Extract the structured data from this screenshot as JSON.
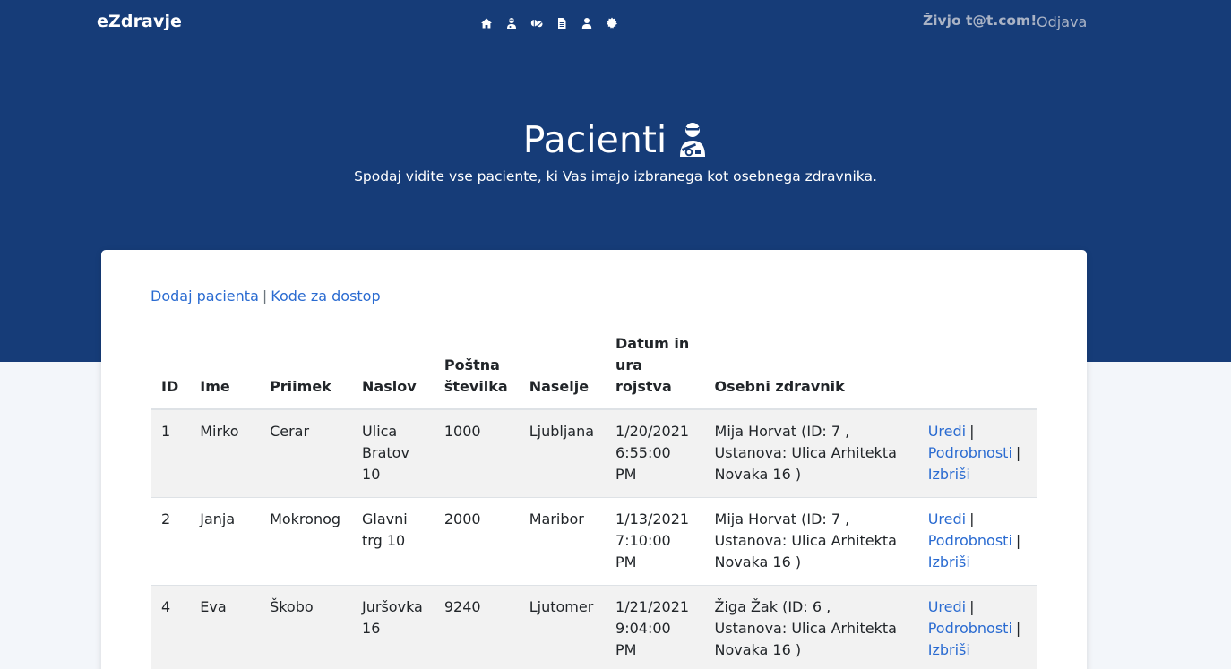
{
  "navbar": {
    "brand": "eZdravje",
    "icons": [
      "home-icon",
      "user-injured-icon",
      "pills-icon",
      "file-icon",
      "user-icon",
      "settings-icon"
    ],
    "greeting": "Živjo t@t.com!",
    "logout": "Odjava"
  },
  "header": {
    "title": "Pacienti",
    "title_icon": "user-injured-icon",
    "subtitle": "Spodaj vidite vse paciente, ki Vas imajo izbranega kot osebnega zdravnika."
  },
  "actions": {
    "add_patient": "Dodaj pacienta",
    "separator": "|",
    "access_codes": "Kode za dostop"
  },
  "table": {
    "headers": {
      "id": "ID",
      "ime": "Ime",
      "priimek": "Priimek",
      "naslov": "Naslov",
      "postna": "Poštna številka",
      "naselje": "Naselje",
      "datum": "Datum in ura rojstva",
      "zdravnik": "Osebni zdravnik"
    },
    "rows": [
      {
        "id": "1",
        "ime": "Mirko",
        "priimek": "Cerar",
        "naslov": "Ulica Bratov 10",
        "postna": "1000",
        "naselje": "Ljubljana",
        "datum": "1/20/2021 6:55:00 PM",
        "zdravnik": "Mija Horvat (ID: 7 , Ustanova: Ulica Arhitekta Novaka 16 )",
        "uredi": "Uredi",
        "podrobnosti": "Podrobnosti",
        "izbrisi": "Izbriši",
        "bar": "|"
      },
      {
        "id": "2",
        "ime": "Janja",
        "priimek": "Mokronog",
        "naslov": "Glavni trg 10",
        "postna": "2000",
        "naselje": "Maribor",
        "datum": "1/13/2021 7:10:00 PM",
        "zdravnik": "Mija Horvat (ID: 7 , Ustanova: Ulica Arhitekta Novaka 16 )",
        "uredi": "Uredi",
        "podrobnosti": "Podrobnosti",
        "izbrisi": "Izbriši",
        "bar": "|"
      },
      {
        "id": "4",
        "ime": "Eva",
        "priimek": "Škobo",
        "naslov": "Juršovka 16",
        "postna": "9240",
        "naselje": "Ljutomer",
        "datum": "1/21/2021 9:04:00 PM",
        "zdravnik": "Žiga Žak (ID: 6 , Ustanova: Ulica Arhitekta Novaka 16 )",
        "uredi": "Uredi",
        "podrobnosti": "Podrobnosti",
        "izbrisi": "Izbriši",
        "bar": "|"
      }
    ]
  },
  "colors": {
    "header_bg": "#163c78",
    "link": "#2a6bd1",
    "page_bg": "#f3f6fa",
    "stripe": "#f2f2f2"
  }
}
